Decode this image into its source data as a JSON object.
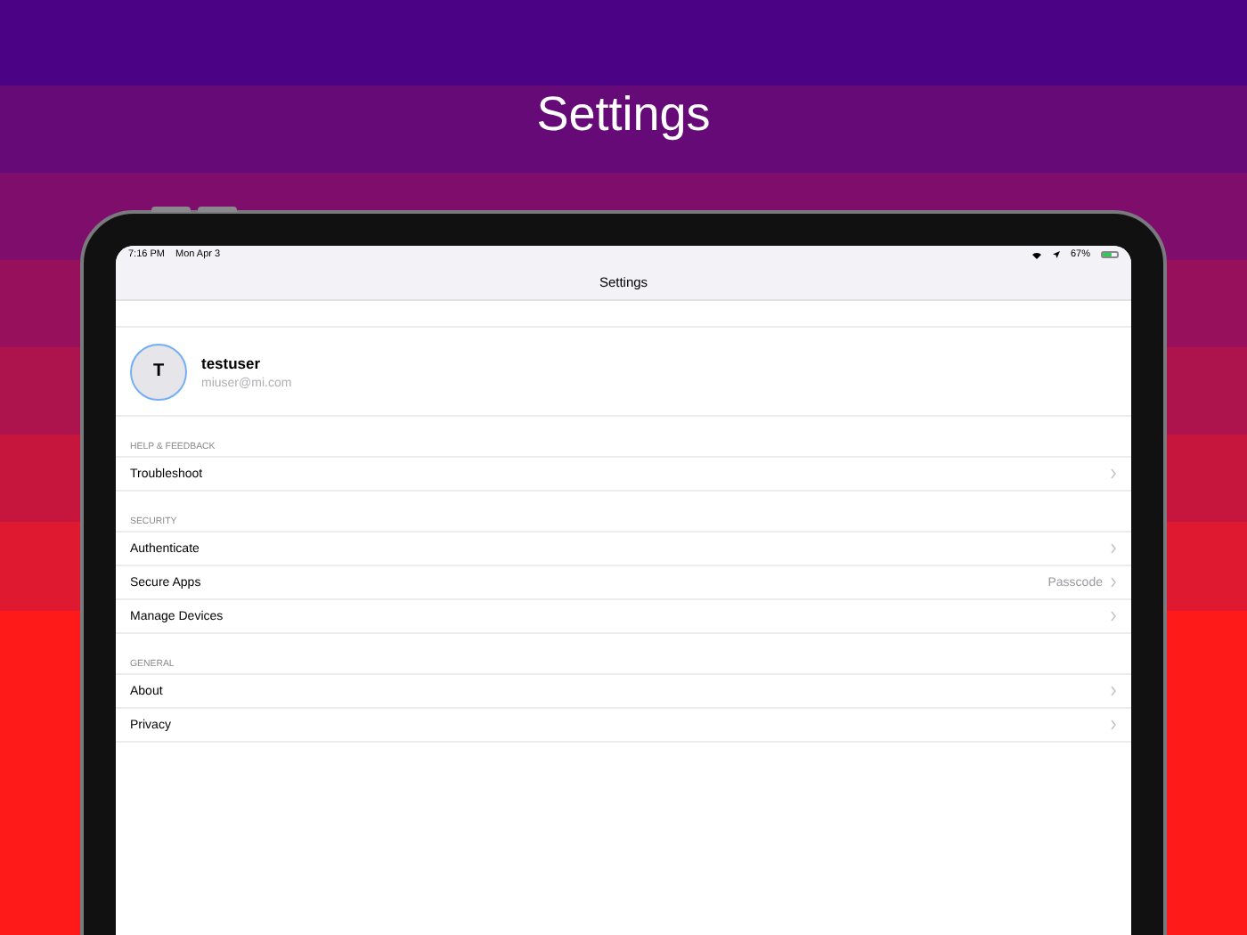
{
  "headline": "Settings",
  "status_bar": {
    "time": "7:16 PM",
    "date": "Mon Apr 3",
    "battery_text": "67%",
    "battery": {
      "level": 0.67
    }
  },
  "nav_bar": {
    "title": "Settings"
  },
  "profile": {
    "initial": "T",
    "username": "testuser",
    "email": "miuser@mi.com"
  },
  "sections": [
    {
      "header": "HELP & FEEDBACK",
      "rows": [
        {
          "label": "Troubleshoot"
        }
      ]
    },
    {
      "header": "SECURITY",
      "rows": [
        {
          "label": "Authenticate"
        },
        {
          "label": "Secure Apps",
          "value": "Passcode"
        },
        {
          "label": "Manage Devices"
        }
      ]
    },
    {
      "header": "GENERAL",
      "rows": [
        {
          "label": "About"
        },
        {
          "label": "Privacy"
        }
      ]
    }
  ]
}
